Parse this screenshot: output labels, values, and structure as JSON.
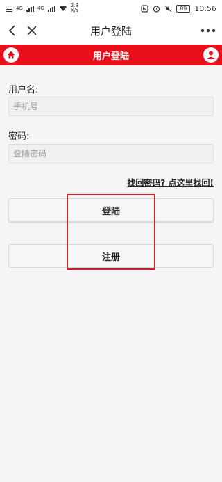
{
  "status_bar": {
    "network_a": "4G",
    "network_b": "4G",
    "speed_value": "2.8",
    "speed_unit": "K/s",
    "battery": "89",
    "time": "10:56"
  },
  "title_bar": {
    "title": "用户登陆"
  },
  "header": {
    "title": "用户登陆",
    "color": "#e8101a"
  },
  "form": {
    "username_label": "用户名:",
    "username_placeholder": "手机号",
    "password_label": "密码:",
    "password_placeholder": "登陆密码",
    "forgot_link": "找回密码? 点这里找回!"
  },
  "buttons": {
    "login": "登陆",
    "register": "注册"
  },
  "highlight_color": "#c0282e"
}
